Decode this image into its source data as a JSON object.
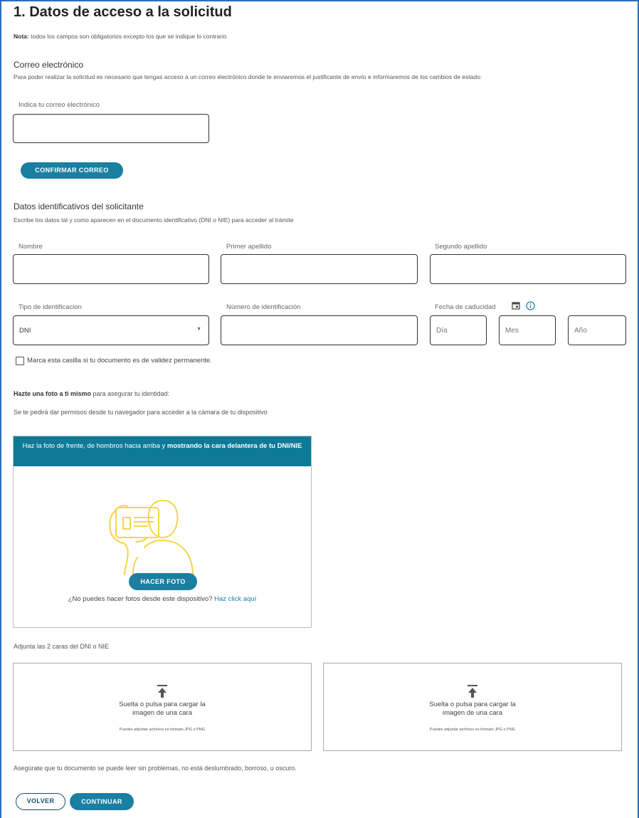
{
  "page": {
    "title": "1. Datos de acceso a la solicitud",
    "note_bold": "Nota:",
    "note_text": "todos los campos son obligatorios excepto los que se indique lo contrario"
  },
  "email": {
    "section_title": "Correo electrónico",
    "description": "Para poder realizar la solicitud es necesario que tengas acceso a un correo electrónico donde te enviaremos el justificante de envío e informaremos de los cambios de estado:",
    "label": "Indica tu correo electrónico",
    "value": "",
    "confirm_label": "CONFIRMAR CORREO"
  },
  "applicant": {
    "section_title": "Datos identificativos del solicitante",
    "description": "Escribe los datos tal y como aparecen en el documento identificativo (DNI o NIE) para acceder al trámite",
    "name_label": "Nombre",
    "surname1_label": "Primer apellido",
    "surname2_label": "Segundo apellido",
    "id_type_label": "Tipo de identificacion",
    "id_type_value": "DNI",
    "id_number_label": "Número de identificación",
    "expiry_label": "Fecha de caducidad",
    "day_placeholder": "Día",
    "month_placeholder": "Mes",
    "year_placeholder": "Año",
    "permanent_checkbox_label": "Marca esta casilla si tu documento es de validez permanente.",
    "permanent_checked": false
  },
  "selfie": {
    "heading_bold": "Hazte una foto a ti mismo",
    "heading_rest": "para asegurar tu identidad:",
    "permissions_note": "Se te pedirá dar permisos desde tu navegador para acceder a la cámara de tu dispositivo",
    "card_header_part1": "Haz la foto de frente, de hombros hacia arriba y",
    "card_header_bold": "mostrando la cara delantera de tu DNI/NIE",
    "take_photo_label": "HACER FOTO",
    "no_camera_text": "¿No puedes hacer fotos desde este dispositivo?",
    "no_camera_link": "Haz click aquí",
    "illustration_color": "#f5d54a",
    "header_color": "#0f7a95"
  },
  "upload": {
    "instructions": "Adjunta las 2 caras del DNI o NIE",
    "box1_line1": "Suelta o pulsa para cargar la",
    "box1_line2": "imagen de una cara",
    "box1_hint": "Puedes adjuntar archivos en formato JPG o PNG",
    "box2_line1": "Suelta o pulsa para cargar la",
    "box2_line2": "imagen de una cara",
    "box2_hint": "Puedes adjuntar archivos en formato JPG o PNG",
    "quality_note": "Asegúrate que tu documento se puede leer sin problemas, no está deslumbrado, borroso, u oscuro."
  },
  "footer": {
    "back_label": "VOLVER",
    "continue_label": "CONTINUAR"
  },
  "colors": {
    "primary": "#1a7fa0",
    "link": "#1a7fa0",
    "frame": "#2a6ebb"
  }
}
